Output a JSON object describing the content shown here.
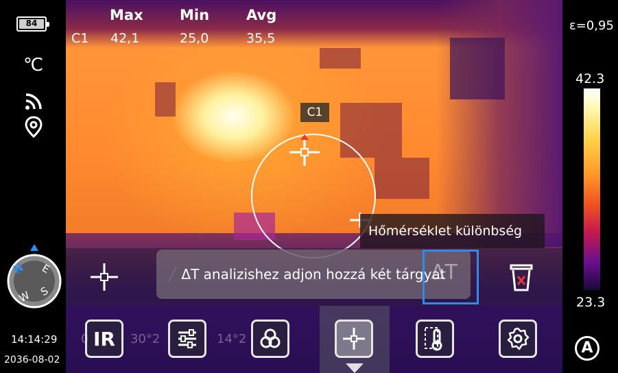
{
  "status": {
    "battery": "84",
    "unit": "℃",
    "time": "14:14:29",
    "date": "2036-08-02",
    "icons": [
      "battery-icon",
      "wifi-icon",
      "location-pin-icon",
      "compass-icon"
    ]
  },
  "measurement": {
    "headers": {
      "max": "Max",
      "min": "Min",
      "avg": "Avg"
    },
    "row": {
      "label": "C1",
      "max": "42,1",
      "min": "25,0",
      "avg": "35,5"
    },
    "marker_label": "C1"
  },
  "compass": {
    "n": "N",
    "e": "E",
    "s": "S",
    "w": "W"
  },
  "overlay": {
    "tooltip": "Hőmérséklet különbség",
    "toast": "ΔT analizishez adjon hozzá két tárgyat"
  },
  "toolbar": {
    "tools": [
      "spot-tool",
      "line-tool",
      "circle-tool",
      "box-tool",
      "polygon-tool",
      "delta-t-tool",
      "delete-tool"
    ],
    "ghost_left": "30°2",
    "ghost_mid": "14°2",
    "ghost_far": "0"
  },
  "bottom_buttons": [
    {
      "label": "IR",
      "icon": "ir-mode-icon"
    },
    {
      "label": "",
      "icon": "sliders-icon"
    },
    {
      "label": "",
      "icon": "palette-icon"
    },
    {
      "label": "",
      "icon": "crosshair-icon"
    },
    {
      "label": "",
      "icon": "thermometer-icon"
    },
    {
      "label": "",
      "icon": "settings-gear-icon"
    }
  ],
  "scale": {
    "emissivity": "ε=0,95",
    "max": "42.3",
    "min": "23.3",
    "auto": "A"
  },
  "colors": {
    "selection": "#2d8cf0",
    "delete": "#e53935"
  }
}
